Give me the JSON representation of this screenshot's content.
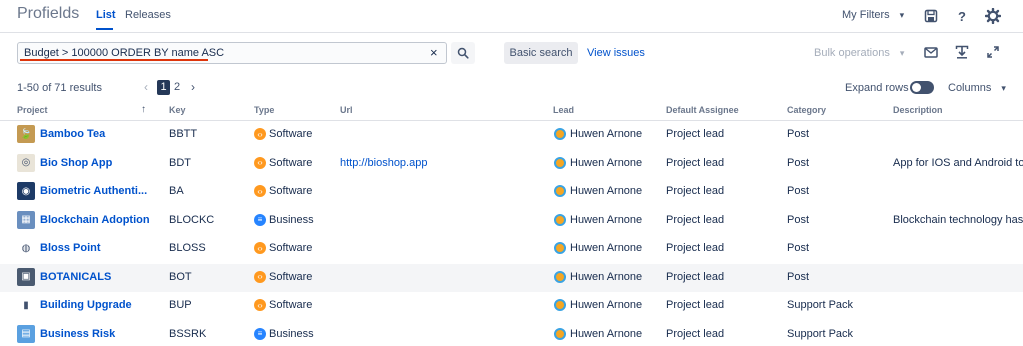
{
  "header": {
    "brand": "Profields",
    "tabs": [
      "List",
      "Releases"
    ],
    "my_filters": "My Filters",
    "help_icon": "?"
  },
  "search": {
    "query": "Budget > 100000 ORDER BY name ASC",
    "clear": "×",
    "basic_search": "Basic search",
    "view_issues": "View issues",
    "bulk_operations": "Bulk operations"
  },
  "results": {
    "summary": "1-50 of 71 results",
    "pages": [
      "1",
      "2"
    ],
    "current_page": "1",
    "expand_rows": "Expand rows",
    "columns": "Columns"
  },
  "table": {
    "columns": [
      "Project",
      "Key",
      "Type",
      "Url",
      "Lead",
      "Default Assignee",
      "Category",
      "Description"
    ],
    "rows": [
      {
        "project": "Bamboo Tea",
        "key": "BBTT",
        "type": "Software",
        "url": "",
        "lead": "Huwen Arnone",
        "assignee": "Project lead",
        "category": "Post",
        "description": ""
      },
      {
        "project": "Bio Shop App",
        "key": "BDT",
        "type": "Software",
        "url": "http://bioshop.app",
        "lead": "Huwen Arnone",
        "assignee": "Project lead",
        "category": "Post",
        "description": "App for IOS and Android to f"
      },
      {
        "project": "Biometric Authenti...",
        "key": "BA",
        "type": "Software",
        "url": "",
        "lead": "Huwen Arnone",
        "assignee": "Project lead",
        "category": "Post",
        "description": ""
      },
      {
        "project": "Blockchain Adoption",
        "key": "BLOCKC",
        "type": "Business",
        "url": "",
        "lead": "Huwen Arnone",
        "assignee": "Project lead",
        "category": "Post",
        "description": "Blockchain technology has r"
      },
      {
        "project": "Bloss Point",
        "key": "BLOSS",
        "type": "Software",
        "url": "",
        "lead": "Huwen Arnone",
        "assignee": "Project lead",
        "category": "Post",
        "description": ""
      },
      {
        "project": "BOTANICALS",
        "key": "BOT",
        "type": "Software",
        "url": "",
        "lead": "Huwen Arnone",
        "assignee": "Project lead",
        "category": "Post",
        "description": ""
      },
      {
        "project": "Building Upgrade",
        "key": "BUP",
        "type": "Software",
        "url": "",
        "lead": "Huwen Arnone",
        "assignee": "Project lead",
        "category": "Support Pack",
        "description": ""
      },
      {
        "project": "Business Risk",
        "key": "BSSRK",
        "type": "Business",
        "url": "",
        "lead": "Huwen Arnone",
        "assignee": "Project lead",
        "category": "Support Pack",
        "description": ""
      }
    ]
  },
  "colors": {
    "accent": "#0052cc",
    "software": "#ff991f",
    "business": "#2684ff",
    "highlight_row": "#f4f5f7",
    "query_underline": "#de350b"
  }
}
